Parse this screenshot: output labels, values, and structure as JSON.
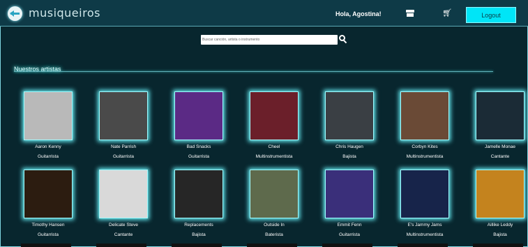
{
  "header": {
    "brand": "musiqueiros",
    "greeting": "Hola, Agostina!",
    "logout_label": "Logout",
    "icons": [
      "app-logo-icon",
      "store-icon",
      "cart-icon"
    ]
  },
  "search": {
    "placeholder": "Buscar canción, artista o instrumento"
  },
  "section": {
    "title": "Nuestros artistas"
  },
  "artists": [
    {
      "name": "Aaron Kenny",
      "role": "Guitarrista",
      "photo_color": "#b9b9b9"
    },
    {
      "name": "Nate Parrish",
      "role": "Guitarrista",
      "photo_color": "#4a4a4a"
    },
    {
      "name": "Bad Snacks",
      "role": "Guitarrista",
      "photo_color": "#5b2a85"
    },
    {
      "name": "Cheel",
      "role": "Multinstrumentista",
      "photo_color": "#6b1f2a"
    },
    {
      "name": "Chris Haugen",
      "role": "Bajista",
      "photo_color": "#3a3f44"
    },
    {
      "name": "Corbyn Kites",
      "role": "Multinstrumentista",
      "photo_color": "#6a4a36"
    },
    {
      "name": "Jamelle Monae",
      "role": "Cantante",
      "photo_color": "#1b2b36"
    },
    {
      "name": "Timothy Hansen",
      "role": "Guitarrista",
      "photo_color": "#2c1c10"
    },
    {
      "name": "Delicate Steve",
      "role": "Cantante",
      "photo_color": "#d9d9d9"
    },
    {
      "name": "Replacements",
      "role": "Bajista",
      "photo_color": "#262626"
    },
    {
      "name": "Outside In",
      "role": "Baterista",
      "photo_color": "#5e6a4c"
    },
    {
      "name": "Emmit Fenn",
      "role": "Guitarrista",
      "photo_color": "#3a2f7a"
    },
    {
      "name": "E's Jammy Jams",
      "role": "Multinstrumentista",
      "photo_color": "#17244a"
    },
    {
      "name": "Aillike Leddy",
      "role": "Bajista",
      "photo_color": "#c4831e"
    }
  ],
  "colors": {
    "background": "#08262e",
    "navbar": "#0e3a47",
    "accent": "#00e5f7",
    "glow": "#67f0f7"
  }
}
